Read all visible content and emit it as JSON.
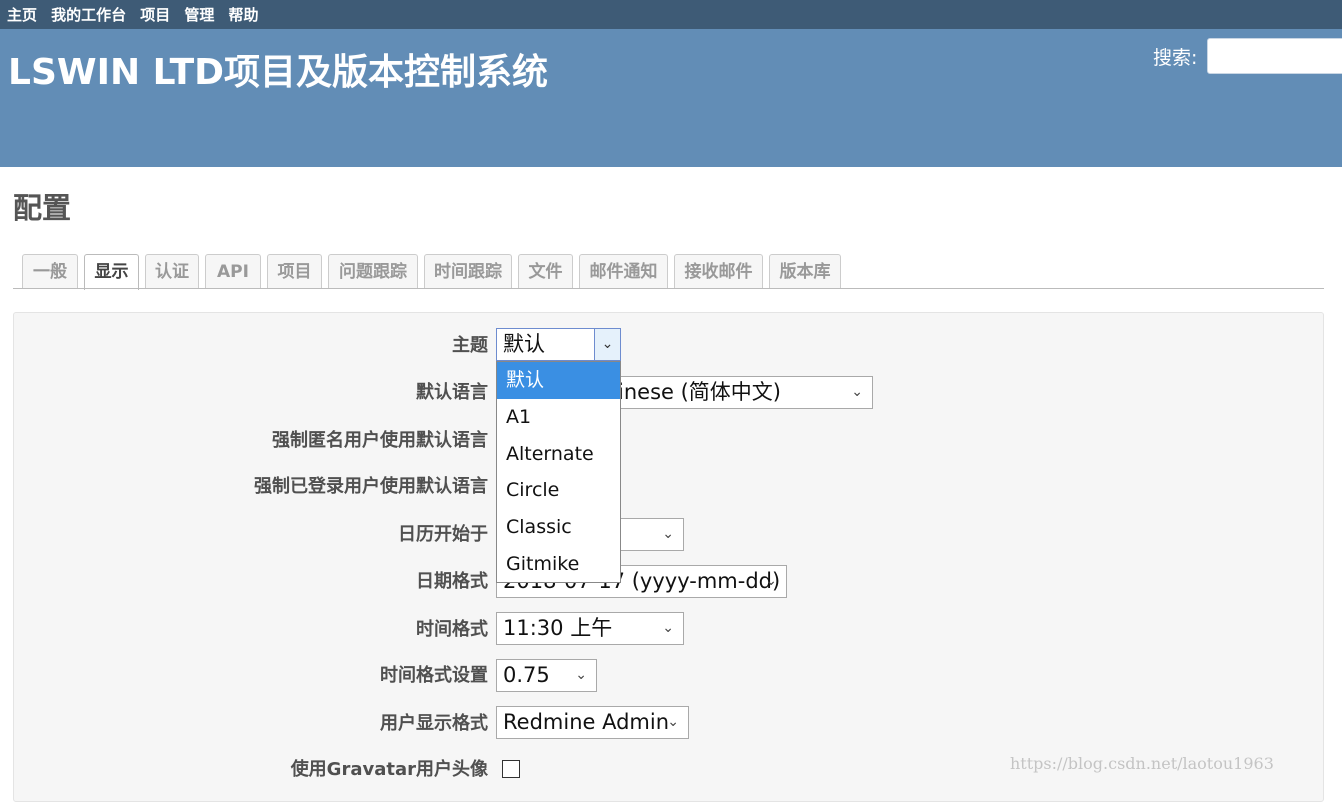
{
  "top_menu": [
    "主页",
    "我的工作台",
    "项目",
    "管理",
    "帮助"
  ],
  "site_title": "LSWIN LTD项目及版本控制系统",
  "search": {
    "label": "搜索:",
    "value": ""
  },
  "page_title": "配置",
  "tabs": [
    "一般",
    "显示",
    "认证",
    "API",
    "项目",
    "问题跟踪",
    "时间跟踪",
    "文件",
    "邮件通知",
    "接收邮件",
    "版本库"
  ],
  "selected_tab": "显示",
  "settings": {
    "theme": {
      "label": "主题",
      "value": "默认"
    },
    "default_language": {
      "label": "默认语言",
      "value": "Chinese (简体中文)",
      "visible_value": "inese (简体中文)"
    },
    "force_anon_language": {
      "label": "强制匿名用户使用默认语言"
    },
    "force_user_language": {
      "label": "强制已登录用户使用默认语言"
    },
    "start_of_week": {
      "label": "日历开始于",
      "value": ""
    },
    "date_format": {
      "label": "日期格式",
      "value": "2018-07-17 (yyyy-mm-dd)",
      "visible_value": "2018-07-17 (yyyy-mm-dd)"
    },
    "time_format": {
      "label": "时间格式",
      "value": "11:30 上午"
    },
    "timespan_format": {
      "label": "时间格式设置",
      "value": "0.75"
    },
    "user_format": {
      "label": "用户显示格式",
      "value": "Redmine Admin"
    },
    "gravatar": {
      "label": "使用Gravatar用户头像",
      "checked": false
    }
  },
  "theme_dropdown": {
    "options": [
      "默认",
      "A1",
      "Alternate",
      "Circle",
      "Classic",
      "Gitmike"
    ],
    "highlighted": "默认"
  },
  "watermark": "https://blog.csdn.net/laotou1963",
  "colors": {
    "top_menu_bg": "#3e5b76",
    "header_bg": "#628db6",
    "highlight": "#3a8fe3"
  },
  "icons": {
    "select_arrow": "chevron-down-icon"
  }
}
